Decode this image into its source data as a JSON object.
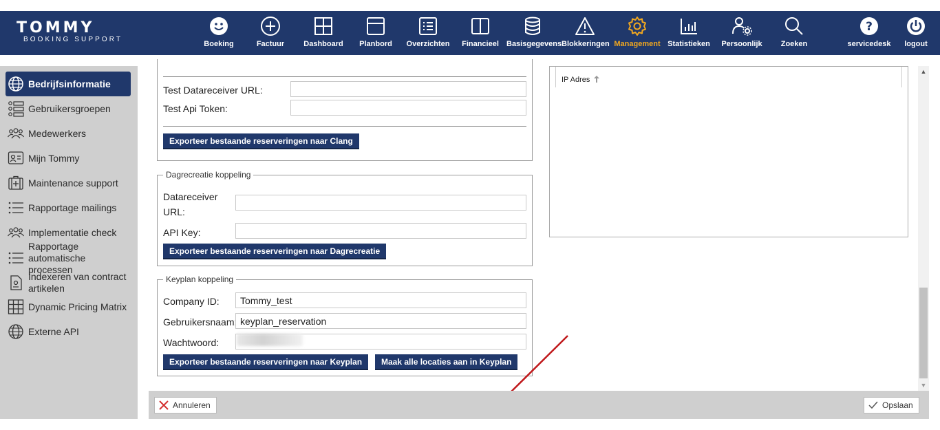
{
  "brand": {
    "line1": "TOMMY",
    "line2": "BOOKING SUPPORT"
  },
  "nav": {
    "boeking": "Boeking",
    "factuur": "Factuur",
    "dashboard": "Dashboard",
    "planbord": "Planbord",
    "overzichten": "Overzichten",
    "financieel": "Financieel",
    "basisgegevens": "Basisgegevens",
    "blokkeringen": "Blokkeringen",
    "management": "Management",
    "statistieken": "Statistieken",
    "persoonlijk": "Persoonlijk",
    "zoeken": "Zoeken",
    "servicedesk": "servicedesk",
    "logout": "logout",
    "active_color": "#f2a81f"
  },
  "sidebar": {
    "bedrijfsinformatie": "Bedrijfsinformatie",
    "gebruikersgroepen": "Gebruikersgroepen",
    "medewerkers": "Medewerkers",
    "mijn_tommy": "Mijn Tommy",
    "maintenance_support": "Maintenance support",
    "rapportage_mailings": "Rapportage mailings",
    "implementatie_check": "Implementatie check",
    "rapportage_automatische": "Rapportage automatische processen",
    "indexeren": "Indexeren van contract artikelen",
    "dynamic_pricing": "Dynamic Pricing Matrix",
    "externe_api": "Externe API"
  },
  "clang": {
    "test_datareceiver_label": "Test Datareceiver URL:",
    "test_datareceiver_value": "",
    "test_api_token_label": "Test Api Token:",
    "test_api_token_value": "",
    "export_button": "Exporteer bestaande reserveringen naar Clang"
  },
  "dagrecreatie": {
    "legend": "Dagrecreatie koppeling",
    "datareceiver_label_1": "Datareceiver",
    "datareceiver_label_2": "URL:",
    "datareceiver_value": "",
    "api_key_label": "API Key:",
    "api_key_value": "",
    "export_button": "Exporteer bestaande reserveringen naar Dagrecreatie"
  },
  "keyplan": {
    "legend": "Keyplan koppeling",
    "company_id_label": "Company ID:",
    "company_id_value": "Tommy_test",
    "username_label": "Gebruikersnaam:",
    "username_value": "keyplan_reservation",
    "password_label": "Wachtwoord:",
    "export_button": "Exporteer bestaande reserveringen naar Keyplan",
    "locations_button": "Maak alle locaties aan in Keyplan"
  },
  "ip_panel": {
    "column_header": "IP Adres"
  },
  "footer": {
    "cancel": "Annuleren",
    "save": "Opslaan"
  },
  "colors": {
    "brand_blue": "#20386b",
    "highlight": "#f2a81f",
    "arrow_red": "#c0191c",
    "sidebar_gray": "#cfcfcf"
  }
}
